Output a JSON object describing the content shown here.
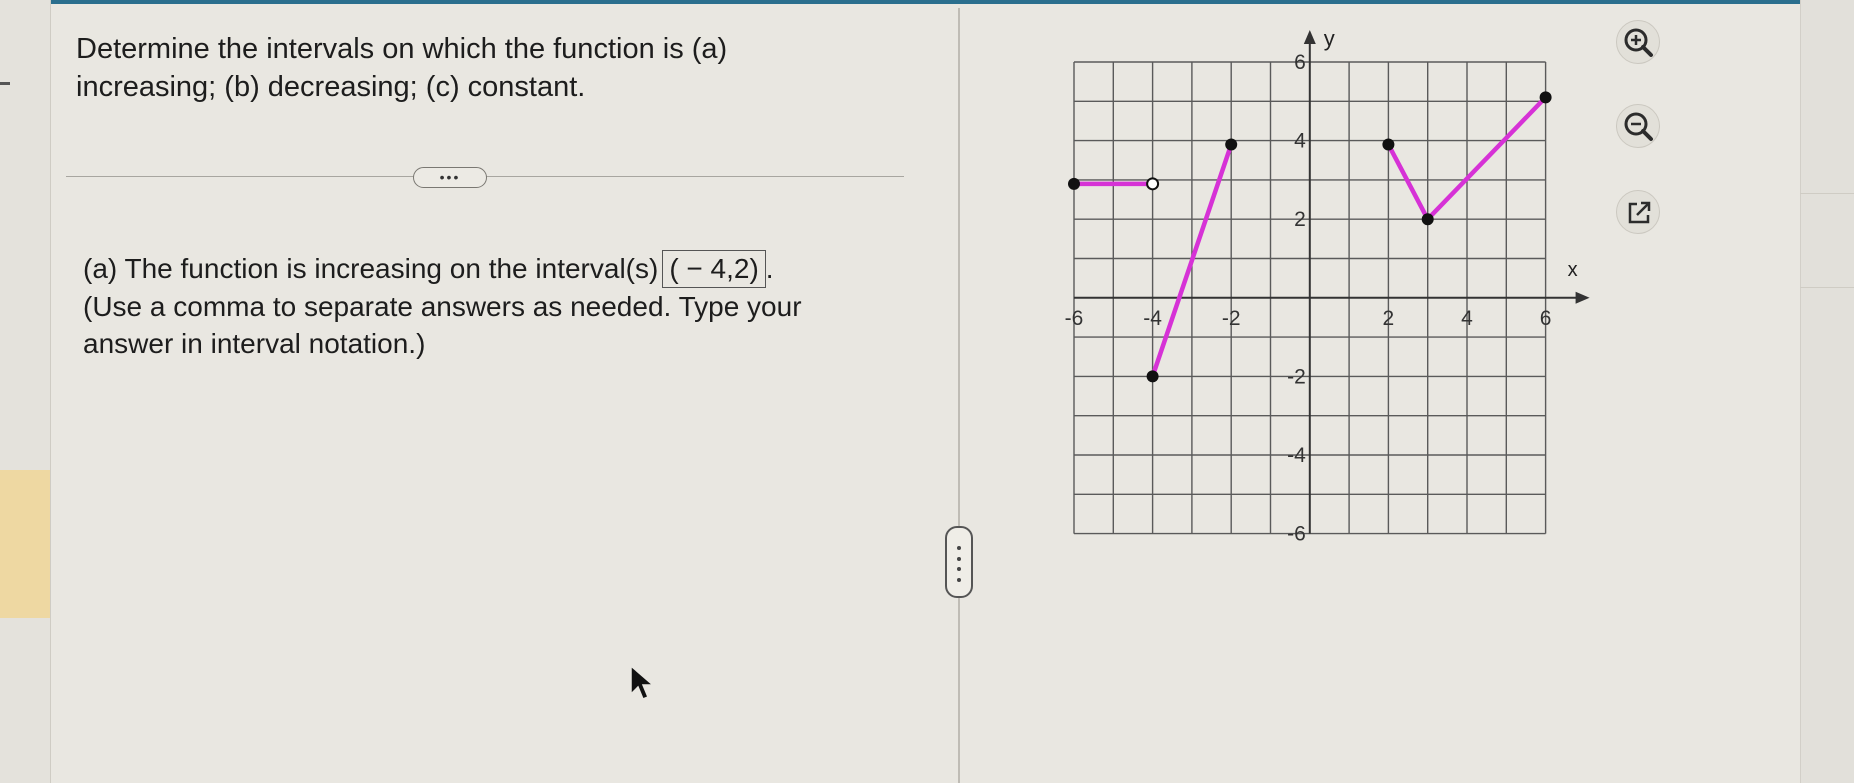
{
  "question": {
    "line1": "Determine the intervals on which the function is (a)",
    "line2": "increasing; (b) decreasing; (c) constant."
  },
  "more_button": {
    "label": "•••"
  },
  "answer": {
    "prefix": "(a) The function is increasing on the interval(s)",
    "value": "( − 4,2)",
    "suffix": ".",
    "hint_line1": "(Use a comma to separate answers as needed. Type your",
    "hint_line2": "answer in interval notation.)"
  },
  "tools": {
    "zoom_in_icon": "zoom-in-icon",
    "zoom_out_icon": "zoom-out-icon",
    "open_external_icon": "open-external-icon"
  },
  "colors": {
    "function_line": "#d632d6",
    "grid": "#5a5a5a",
    "points": "#111111"
  },
  "chart_data": {
    "type": "line",
    "xlabel": "x",
    "ylabel": "y",
    "xlim": [
      -6,
      6
    ],
    "ylim": [
      -6,
      6
    ],
    "grid": true,
    "x_tick_labels": [
      "-6",
      "-4",
      "-2",
      "2",
      "4",
      "6"
    ],
    "y_tick_labels": [
      "6",
      "4",
      "2",
      "-2",
      "-4",
      "-6"
    ],
    "segments": [
      {
        "points": [
          [
            -6,
            2.9
          ],
          [
            -4,
            2.9
          ]
        ],
        "start": "closed",
        "end": "open"
      },
      {
        "points": [
          [
            -4,
            -2
          ],
          [
            -2,
            3.9
          ]
        ],
        "start": "closed",
        "end": "closed"
      },
      {
        "points": [
          [
            2,
            3.9
          ],
          [
            3,
            2
          ],
          [
            6,
            5.1
          ]
        ],
        "start": "closed",
        "end": "closed",
        "vertex": "closed"
      }
    ]
  }
}
